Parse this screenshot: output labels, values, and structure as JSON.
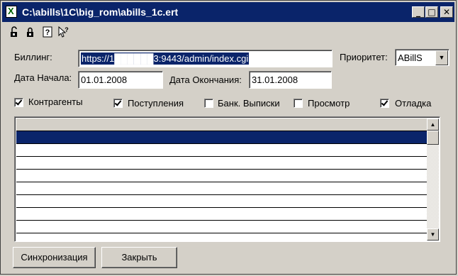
{
  "window": {
    "title": "C:\\abills\\1C\\big_rom\\abills_1c.ert",
    "minimize_glyph": "_",
    "maximize_glyph": "□",
    "close_glyph": "✕"
  },
  "toolbar": {
    "icons": [
      "unlock-icon",
      "lock-icon",
      "help-icon",
      "context-help-icon"
    ]
  },
  "form": {
    "billing_label": "Биллинг:",
    "billing_value": "https://1██████3:9443/admin/index.cgi",
    "priority_label": "Приоритет:",
    "priority_value": "ABillS",
    "start_date_label": "Дата Начала:",
    "start_date_value": "01.01.2008",
    "end_date_label": "Дата Окончания:",
    "end_date_value": "31.01.2008"
  },
  "checkboxes": [
    {
      "label": "Контрагенты",
      "checked": true
    },
    {
      "label": "Поступления",
      "checked": true
    },
    {
      "label": "Банк. Выписки",
      "checked": false
    },
    {
      "label": "Просмотр",
      "checked": false
    },
    {
      "label": "Отладка",
      "checked": true
    }
  ],
  "grid": {
    "rows": [
      "",
      "",
      "",
      "",
      "",
      "",
      "",
      ""
    ],
    "selected_row": 0,
    "scroll_up_glyph": "▲",
    "scroll_down_glyph": "▼"
  },
  "buttons": {
    "sync_label": "Синхронизация",
    "close_label": "Закрыть"
  },
  "colors": {
    "titlebar": "#0a246a",
    "selection": "#0a246a",
    "face": "#d4d0c8"
  }
}
